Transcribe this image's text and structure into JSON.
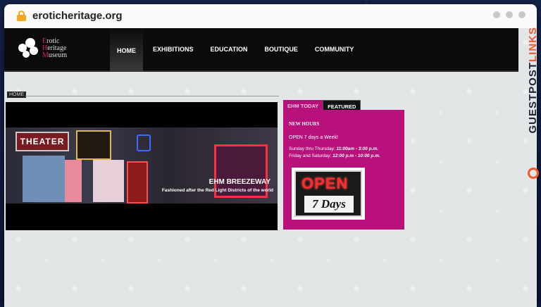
{
  "browser": {
    "url": "eroticheritage.org"
  },
  "site": {
    "logo": {
      "line1_cap": "E",
      "line1_rest": "rotic",
      "line2_cap": "H",
      "line2_rest": "eritage",
      "line3_cap": "M",
      "line3_rest": "useum"
    },
    "nav": [
      {
        "label": "HOME",
        "active": true
      },
      {
        "label": "EXHIBITIONS",
        "active": false
      },
      {
        "label": "EDUCATION",
        "active": false
      },
      {
        "label": "BOUTIQUE",
        "active": false
      },
      {
        "label": "COMMUNITY",
        "active": false
      }
    ],
    "breadcrumb": "HOME",
    "slider": {
      "sign_text": "THEATER",
      "title": "EHM BREEZEWAY",
      "subtitle": "Fashioned after the Red Light Districts of the world"
    },
    "tabs": [
      {
        "label": "EHM TODAY"
      },
      {
        "label": "FEATURED"
      }
    ],
    "featured": {
      "heading": "NEW HOURS",
      "open_line": "OPEN 7 days a Week!",
      "hours": [
        {
          "days": "Sunday thru Thursday:",
          "time": "11:00am - 3:00 p.m."
        },
        {
          "days": "Friday and Saturday:",
          "time": "12:00 p.m - 10:00 p.m."
        }
      ],
      "sign_open": "OPEN",
      "sign_days": "7 Days"
    }
  },
  "watermark": {
    "guest": "GUEST",
    "post": "POST",
    "links": "LINKS"
  },
  "colors": {
    "accent_magenta": "#b8117c",
    "header_black": "#0b0b0b",
    "watermark_orange": "#f05a28"
  }
}
